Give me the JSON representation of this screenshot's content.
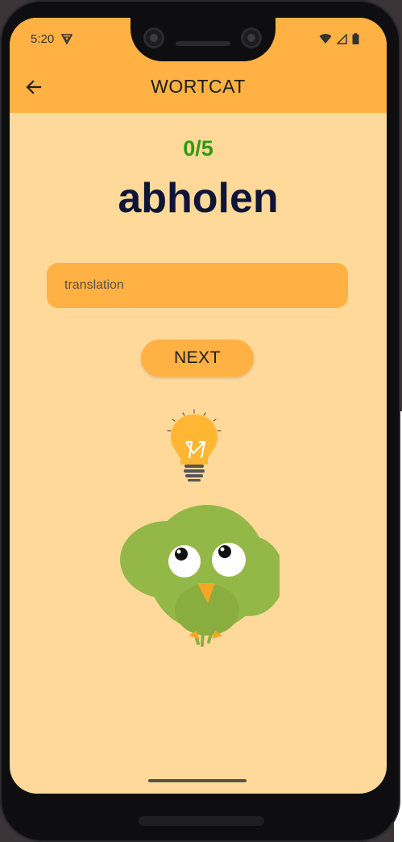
{
  "status_bar": {
    "time": "5:20",
    "icons": [
      "vpn-icon",
      "wifi-icon",
      "signal-icon",
      "battery-icon"
    ]
  },
  "app_bar": {
    "title": "WORTCAT",
    "back_icon": "arrow-back-icon"
  },
  "quiz": {
    "score": "0/5",
    "word": "abholen"
  },
  "translation_input": {
    "placeholder": "translation",
    "value": ""
  },
  "next_button": {
    "label": "NEXT"
  },
  "illustration": {
    "icons": [
      "lightbulb-icon",
      "bird-mascot-icon"
    ]
  },
  "colors": {
    "app_bar": "#ffb143",
    "background": "#ffd99a",
    "score": "#2e9a13",
    "word": "#0f1538",
    "bird": "#94b847"
  }
}
